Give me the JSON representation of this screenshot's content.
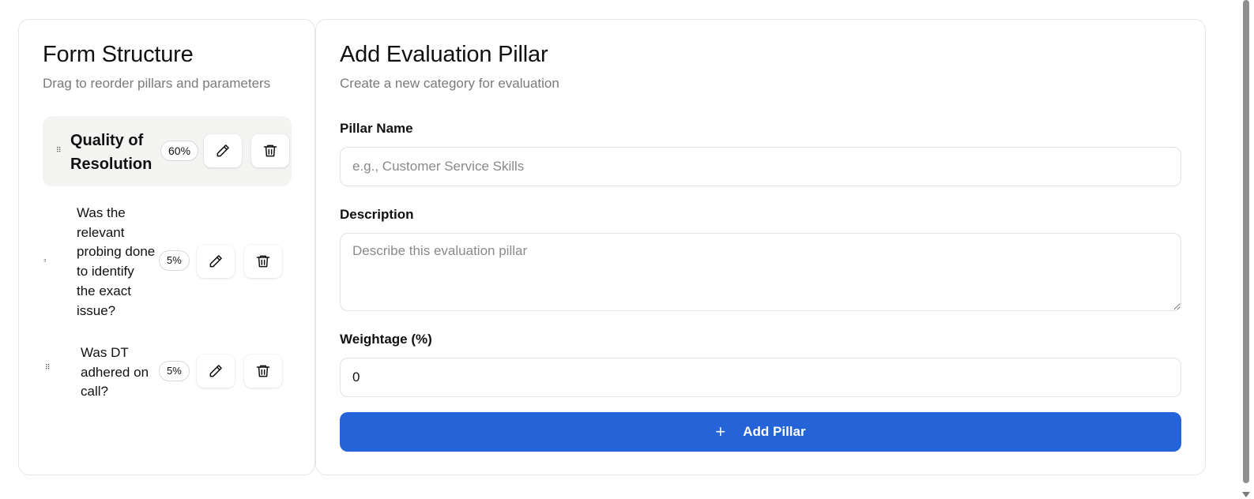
{
  "left_panel": {
    "title": "Form Structure",
    "subtitle": "Drag to reorder pillars and parameters",
    "pillars": [
      {
        "name": "Quality of Resolution",
        "weight": "60%",
        "parameters": [
          {
            "text": "Was the relevant probing done to identify the exact issue?",
            "weight": "5%"
          },
          {
            "text": "Was DT adhered on call?",
            "weight": "5%"
          }
        ]
      }
    ]
  },
  "right_panel": {
    "title": "Add Evaluation Pillar",
    "subtitle": "Create a new category for evaluation",
    "fields": {
      "pillar_name": {
        "label": "Pillar Name",
        "placeholder": "e.g., Customer Service Skills",
        "value": ""
      },
      "description": {
        "label": "Description",
        "placeholder": "Describe this evaluation pillar",
        "value": ""
      },
      "weightage": {
        "label": "Weightage (%)",
        "value": "0"
      }
    },
    "submit": {
      "label": "Add Pillar",
      "icon": "plus-icon"
    }
  },
  "icons": {
    "edit": "pencil-icon",
    "delete": "trash-icon",
    "drag": "drag-handle-icon"
  },
  "colors": {
    "accent": "#2563d9",
    "pillar_bg": "#f4f4f2",
    "border": "#e6e6e6",
    "muted_text": "#7a7a7a"
  }
}
